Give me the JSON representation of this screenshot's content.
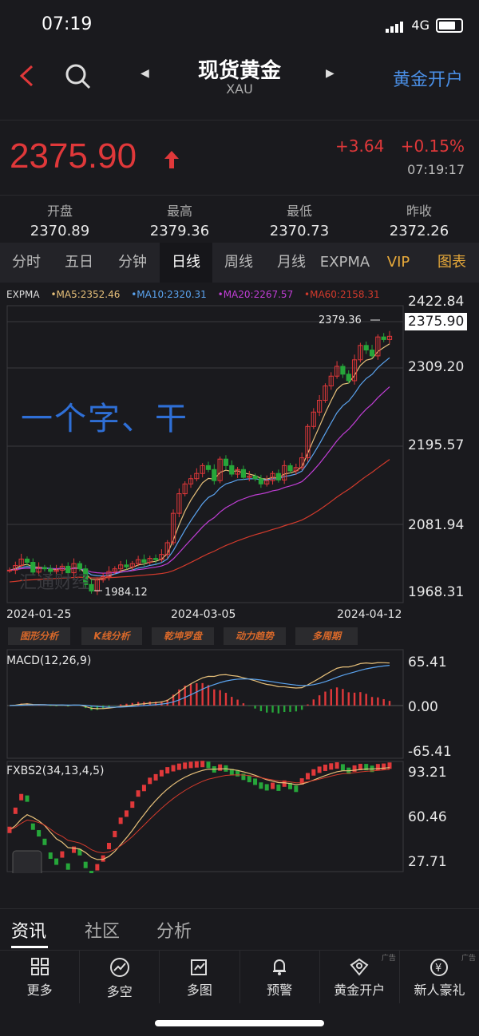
{
  "status": {
    "time": "07:19",
    "network": "4G"
  },
  "header": {
    "title": "现货黄金",
    "subtitle": "XAU",
    "open_account": "黄金开户"
  },
  "quote": {
    "price": "2375.90",
    "change": "+3.64",
    "change_pct": "+0.15%",
    "time": "07:19:17"
  },
  "stats": [
    {
      "label": "开盘",
      "value": "2370.89"
    },
    {
      "label": "最高",
      "value": "2379.36"
    },
    {
      "label": "最低",
      "value": "2370.73"
    },
    {
      "label": "昨收",
      "value": "2372.26"
    }
  ],
  "tabs": [
    "分时",
    "五日",
    "分钟",
    "日线",
    "周线",
    "月线",
    "EXPMA",
    "VIP",
    "图表"
  ],
  "active_tab": "日线",
  "colors": {
    "up": "#e0383a",
    "down": "#26a63a",
    "accent": "#4a8fe6",
    "ma5": "#e7c07a",
    "ma10": "#5ba4f0",
    "ma20": "#c13ed6",
    "ma60": "#d23a2c"
  },
  "chart_data": {
    "type": "candlestick",
    "legend": {
      "expma": "EXPMA",
      "ma5": "•MA5:2352.46",
      "ma10": "•MA10:2320.31",
      "ma20": "•MA20:2267.57",
      "ma60": "•MA60:2158.31"
    },
    "y_ticks": [
      "2422.84",
      "2375.90",
      "2309.20",
      "2195.57",
      "2081.94",
      "1968.31"
    ],
    "x_labels": [
      "2024-01-25",
      "2024-03-05",
      "2024-04-12"
    ],
    "ylim": [
      1968.31,
      2422.84
    ],
    "high_label": "2379.36",
    "low_label": "1984.12",
    "close_sequence": [
      2018,
      2025,
      2035,
      2030,
      2015,
      2022,
      2020,
      2016,
      2018,
      2024,
      2014,
      2028,
      2020,
      1996,
      1986,
      2003,
      2008,
      2016,
      2020,
      2026,
      2023,
      2028,
      2034,
      2030,
      2036,
      2034,
      2042,
      2060,
      2105,
      2135,
      2150,
      2158,
      2166,
      2178,
      2172,
      2155,
      2188,
      2178,
      2165,
      2172,
      2160,
      2162,
      2158,
      2150,
      2155,
      2166,
      2156,
      2178,
      2170,
      2175,
      2190,
      2238,
      2260,
      2278,
      2300,
      2315,
      2330,
      2318,
      2308,
      2340,
      2362,
      2355,
      2346,
      2375,
      2371,
      2376
    ]
  },
  "tools": [
    "图形分析",
    "K线分析",
    "乾坤罗盘",
    "动力趋势",
    "多周期"
  ],
  "macd": {
    "title": "MACD(12,26,9)",
    "ticks": [
      "65.41",
      "0.00",
      "-65.41"
    ]
  },
  "fxbs": {
    "title": "FXBS2(34,13,4,5)",
    "ticks": [
      "93.21",
      "60.46",
      "27.71"
    ]
  },
  "overlay_text": "一个字、干",
  "watermark": "汇通财经",
  "news_tabs": [
    "资讯",
    "社区",
    "分析"
  ],
  "bottom_nav": [
    {
      "label": "更多",
      "icon": "grid-icon"
    },
    {
      "label": "多空",
      "icon": "trend-icon"
    },
    {
      "label": "多图",
      "icon": "multi-chart-icon"
    },
    {
      "label": "预警",
      "icon": "bell-icon"
    },
    {
      "label": "黄金开户",
      "icon": "gift-badge-icon",
      "ad": "广告"
    },
    {
      "label": "新人豪礼",
      "icon": "yuan-bag-icon",
      "ad": "广告"
    }
  ]
}
